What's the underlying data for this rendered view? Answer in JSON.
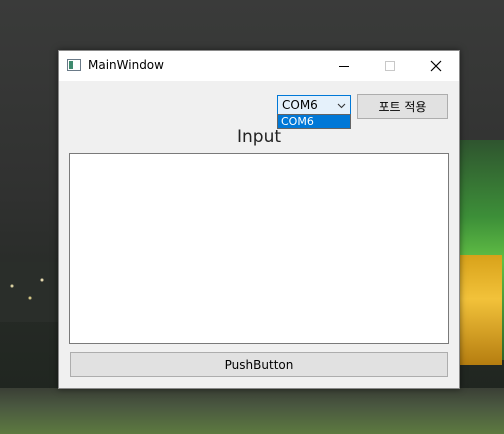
{
  "window": {
    "title": "MainWindow"
  },
  "port_selector": {
    "selected": "COM6",
    "options": [
      "COM6"
    ],
    "highlighted_option": "COM6"
  },
  "toolbar": {
    "apply_port_label": "포트 적용"
  },
  "main": {
    "input_label": "Input",
    "input_text": "",
    "push_button_label": "PushButton"
  },
  "colors": {
    "accent": "#0078d7",
    "button_face": "#e1e1e1",
    "window_bg": "#f0f0f0"
  }
}
